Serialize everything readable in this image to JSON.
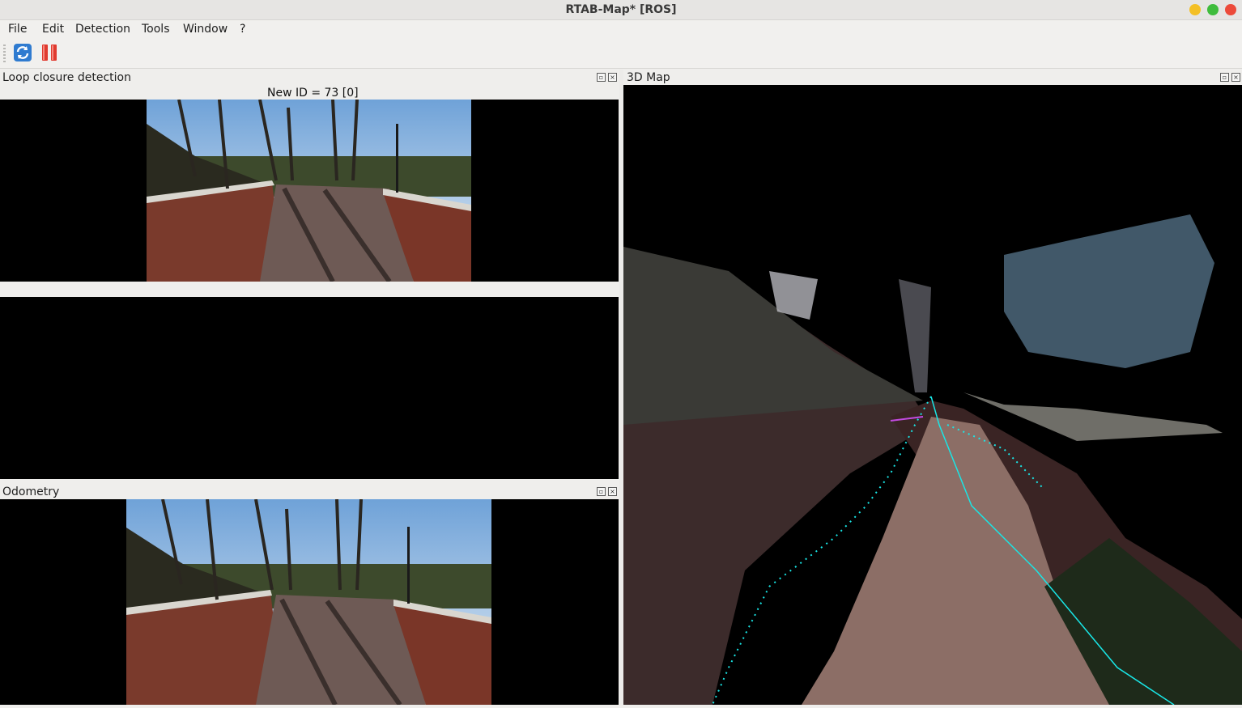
{
  "window": {
    "title": "RTAB-Map* [ROS]"
  },
  "menu": [
    "File",
    "Edit",
    "Detection",
    "Tools",
    "Window",
    "?"
  ],
  "toolbar": {
    "buttons": [
      {
        "icon": "refresh-icon"
      },
      {
        "icon": "pause-icon"
      }
    ]
  },
  "loop_closure": {
    "title": "Loop closure detection",
    "caption": "New ID = 73 [0]"
  },
  "odometry": {
    "title": "Odometry"
  },
  "map3d": {
    "title": "3D Map"
  },
  "colors": {
    "trajectory": "#19e6e6",
    "panel_bg": "#000000",
    "chrome": "#efeeec"
  }
}
